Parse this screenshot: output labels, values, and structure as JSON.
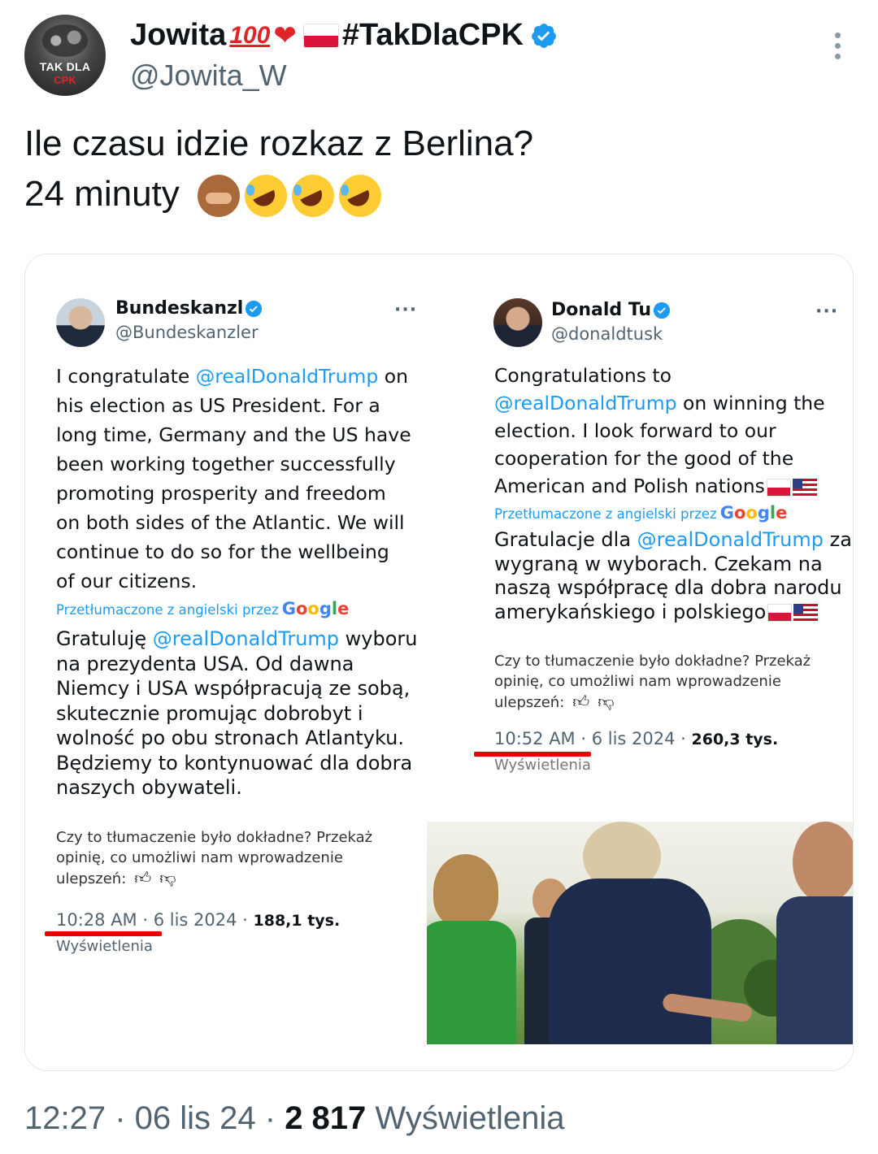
{
  "author": {
    "avatar_text_line1": "TAK DLA",
    "avatar_text_line2": "CPK",
    "display_name_prefix": "Jowita",
    "display_name_suffix": "#TakDlaCPK",
    "handle": "@Jowita_W"
  },
  "tweet": {
    "line1": "Ile czasu idzie rozkaz z Berlina?",
    "line2": "24 minuty"
  },
  "inner_left": {
    "name": "Bundeskanzl",
    "handle": "@Bundeskanzler",
    "text_lines": [
      "I congratulate ",
      "@realDonaldTrump",
      " on",
      "his election as US President. For a",
      "long time, Germany and the US have",
      "been working together successfully",
      "promoting prosperity and freedom",
      "on both sides of the Atlantic. We will",
      "continue to do so for the wellbeing",
      "of our citizens."
    ],
    "translated_by": "Przetłumaczone z angielski przez",
    "google": "Google",
    "pl_lines": [
      "Gratuluję ",
      "@realDonaldTrump",
      " wyboru",
      "na prezydenta USA. Od dawna",
      "Niemcy i USA współpracują ze sobą,",
      "skutecznie promując dobrobyt i",
      "wolność po obu stronach Atlantyku.",
      "Będziemy to kontynuować dla dobra",
      "naszych obywateli."
    ],
    "feedback_lines": [
      "Czy to tłumaczenie było dokładne? Przekaż",
      "opinię, co umożliwi nam wprowadzenie",
      "ulepszeń:"
    ],
    "timestamp": "10:28 AM · 6 lis 2024 · ",
    "views_count": "188,1 tys.",
    "views_label": "Wyświetlenia"
  },
  "inner_right": {
    "name": "Donald Tu",
    "handle": "@donaldtusk",
    "text_lines": [
      "Congratulations to",
      "@realDonaldTrump",
      " on winning the",
      "election. I look forward to our",
      "cooperation for the good of the",
      "American and Polish nations"
    ],
    "translated_by": "Przetłumaczone z angielski przez",
    "google": "Google",
    "pl_lines": [
      "Gratulacje dla ",
      "@realDonaldTrump",
      " za",
      "wygraną w wyborach. Czekam na",
      "naszą współpracę dla dobra narodu",
      "amerykańskiego i polskiego"
    ],
    "feedback_lines": [
      "Czy to tłumaczenie było dokładne? Przekaż",
      "opinię, co umożliwi nam wprowadzenie",
      "ulepszeń:"
    ],
    "timestamp": "10:52 AM · 6 lis 2024 · ",
    "views_count": "260,3 tys.",
    "views_label": "Wyświetlenia"
  },
  "footer": {
    "time": "12:27 · 06 lis 24 · ",
    "views_count": "2 817",
    "views_label": " Wyświetlenia"
  },
  "colors": {
    "link": "#1d9bf0",
    "verified": "#1d9bf0",
    "underline": "#e60000"
  }
}
